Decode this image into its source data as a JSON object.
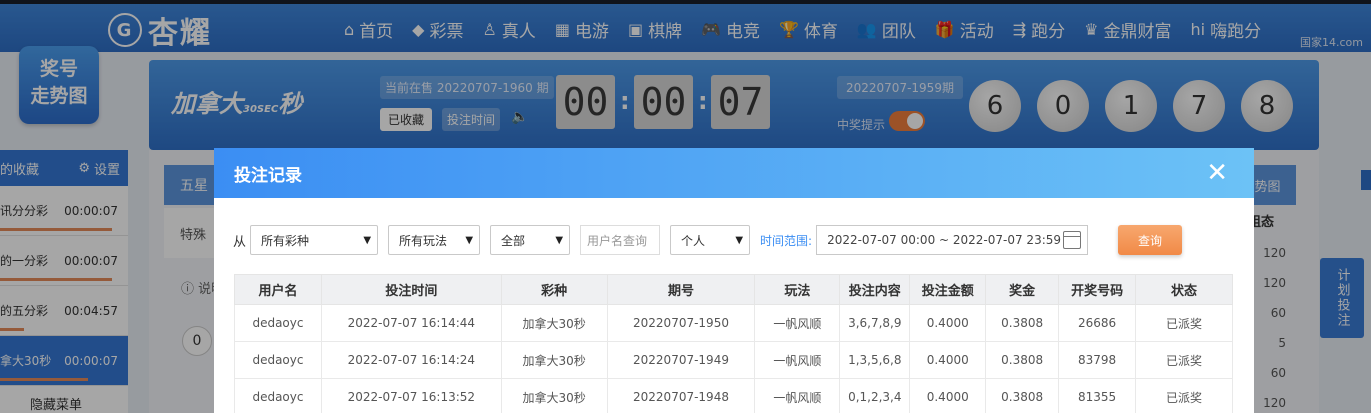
{
  "brand": {
    "name": "杏耀",
    "mark": "G"
  },
  "nav": [
    {
      "icon": "⌂",
      "label": "首页"
    },
    {
      "icon": "◆",
      "label": "彩票"
    },
    {
      "icon": "♙",
      "label": "真人"
    },
    {
      "icon": "▦",
      "label": "电游"
    },
    {
      "icon": "▣",
      "label": "棋牌"
    },
    {
      "icon": "🎮",
      "label": "电竞"
    },
    {
      "icon": "🏆",
      "label": "体育"
    },
    {
      "icon": "👥",
      "label": "团队"
    },
    {
      "icon": "🎁",
      "label": "活动"
    },
    {
      "icon": "⇶",
      "label": "跑分"
    },
    {
      "icon": "♛",
      "label": "金鼎财富"
    },
    {
      "icon": "hi",
      "label": "嗨跑分"
    }
  ],
  "watermark": "国家14.com",
  "trend_button": {
    "line1": "奖号",
    "line2": "走势图"
  },
  "favorites": {
    "title": "的收藏",
    "settings_label": "设置",
    "items": [
      {
        "name": "讯分分彩",
        "time": "00:00:07",
        "progress": 0.9
      },
      {
        "name": "的一分彩",
        "time": "00:00:07",
        "progress": 0.9
      },
      {
        "name": "的五分彩",
        "time": "00:04:57",
        "progress": 0.2
      },
      {
        "name": "拿大30秒",
        "time": "00:00:07",
        "progress": 0.7
      }
    ],
    "hide_menu": "隐藏菜单"
  },
  "game": {
    "name": "加拿大",
    "name_tail": "秒",
    "sub": "30SEC",
    "current_issue_label": "当前在售 20220707-1960 期",
    "fav_button": "已收藏",
    "bet_time_button": "投注时间",
    "countdown": [
      "00",
      "00",
      "07"
    ],
    "prev_issue_label": "20220707-1959期",
    "prize_tip": "中奖提示",
    "result_balls": [
      "6",
      "0",
      "1",
      "7",
      "8"
    ]
  },
  "content": {
    "tab_five": "五星",
    "tab_special": "特殊",
    "desc": "说明",
    "zero": "0",
    "right_head": "走势图",
    "right_sub": "组态",
    "right_values": [
      "120",
      "120",
      "60",
      "5",
      "60",
      "120"
    ]
  },
  "plan_button": "计划投注",
  "modal": {
    "title": "投注记录",
    "close_label": "✕",
    "filters": {
      "from_label": "从",
      "lottery": "所有彩种",
      "play": "所有玩法",
      "scope": "全部",
      "username_placeholder": "用户名查询",
      "who": "个人",
      "range_label": "时间范围:",
      "date_range": "2022-07-07 00:00 ~ 2022-07-07 23:59",
      "query_button": "查询"
    },
    "columns": [
      "用户名",
      "投注时间",
      "彩种",
      "期号",
      "玩法",
      "投注内容",
      "投注金额",
      "奖金",
      "开奖号码",
      "状态"
    ],
    "rows": [
      [
        "dedaoyc",
        "2022-07-07 16:14:44",
        "加拿大30秒",
        "20220707-1950",
        "一帆风顺",
        "3,6,7,8,9",
        "0.4000",
        "0.3808",
        "26686",
        "已派奖"
      ],
      [
        "dedaoyc",
        "2022-07-07 16:14:24",
        "加拿大30秒",
        "20220707-1949",
        "一帆风顺",
        "1,3,5,6,8",
        "0.4000",
        "0.3808",
        "83798",
        "已派奖"
      ],
      [
        "dedaoyc",
        "2022-07-07 16:13:52",
        "加拿大30秒",
        "20220707-1948",
        "一帆风顺",
        "0,1,2,3,4",
        "0.4000",
        "0.3808",
        "81355",
        "已派奖"
      ]
    ]
  }
}
